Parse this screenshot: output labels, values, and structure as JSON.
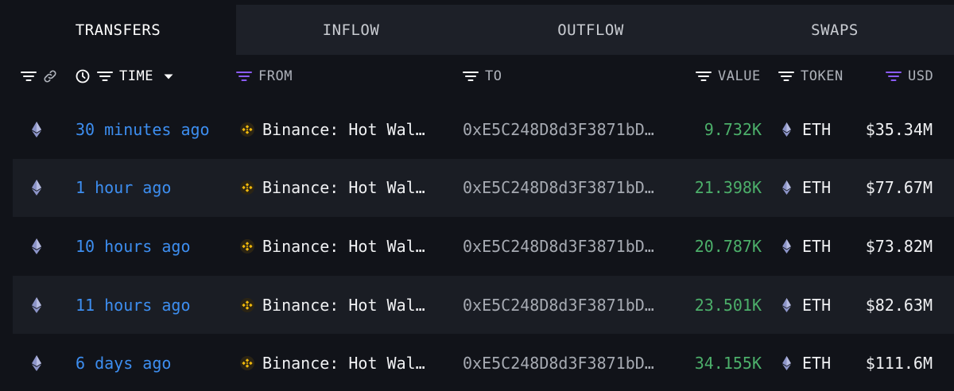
{
  "tabs": [
    {
      "label": "TRANSFERS"
    },
    {
      "label": "INFLOW"
    },
    {
      "label": "OUTFLOW"
    },
    {
      "label": "SWAPS"
    }
  ],
  "header": {
    "time": "TIME",
    "from": "FROM",
    "to": "TO",
    "value": "VALUE",
    "token": "TOKEN",
    "usd": "USD"
  },
  "rows": [
    {
      "time": "30 minutes ago",
      "from": "Binance: Hot Wal…",
      "to": "0xE5C248D8d3F3871bD…",
      "value": "9.732K",
      "token": "ETH",
      "usd": "$35.34M"
    },
    {
      "time": "1 hour ago",
      "from": "Binance: Hot Wal…",
      "to": "0xE5C248D8d3F3871bD…",
      "value": "21.398K",
      "token": "ETH",
      "usd": "$77.67M"
    },
    {
      "time": "10 hours ago",
      "from": "Binance: Hot Wal…",
      "to": "0xE5C248D8d3F3871bD…",
      "value": "20.787K",
      "token": "ETH",
      "usd": "$73.82M"
    },
    {
      "time": "11 hours ago",
      "from": "Binance: Hot Wal…",
      "to": "0xE5C248D8d3F3871bD…",
      "value": "23.501K",
      "token": "ETH",
      "usd": "$82.63M"
    },
    {
      "time": "6 days ago",
      "from": "Binance: Hot Wal…",
      "to": "0xE5C248D8d3F3871bD…",
      "value": "34.155K",
      "token": "ETH",
      "usd": "$111.6M"
    }
  ],
  "colors": {
    "background": "#111319",
    "tab_inactive": "#1d2028",
    "row_alt": "#1a1d24",
    "time_link": "#3d8ef0",
    "value_green": "#4caf6a",
    "filter_purple": "#8b5cf6",
    "binance_yellow": "#f0b90b"
  }
}
